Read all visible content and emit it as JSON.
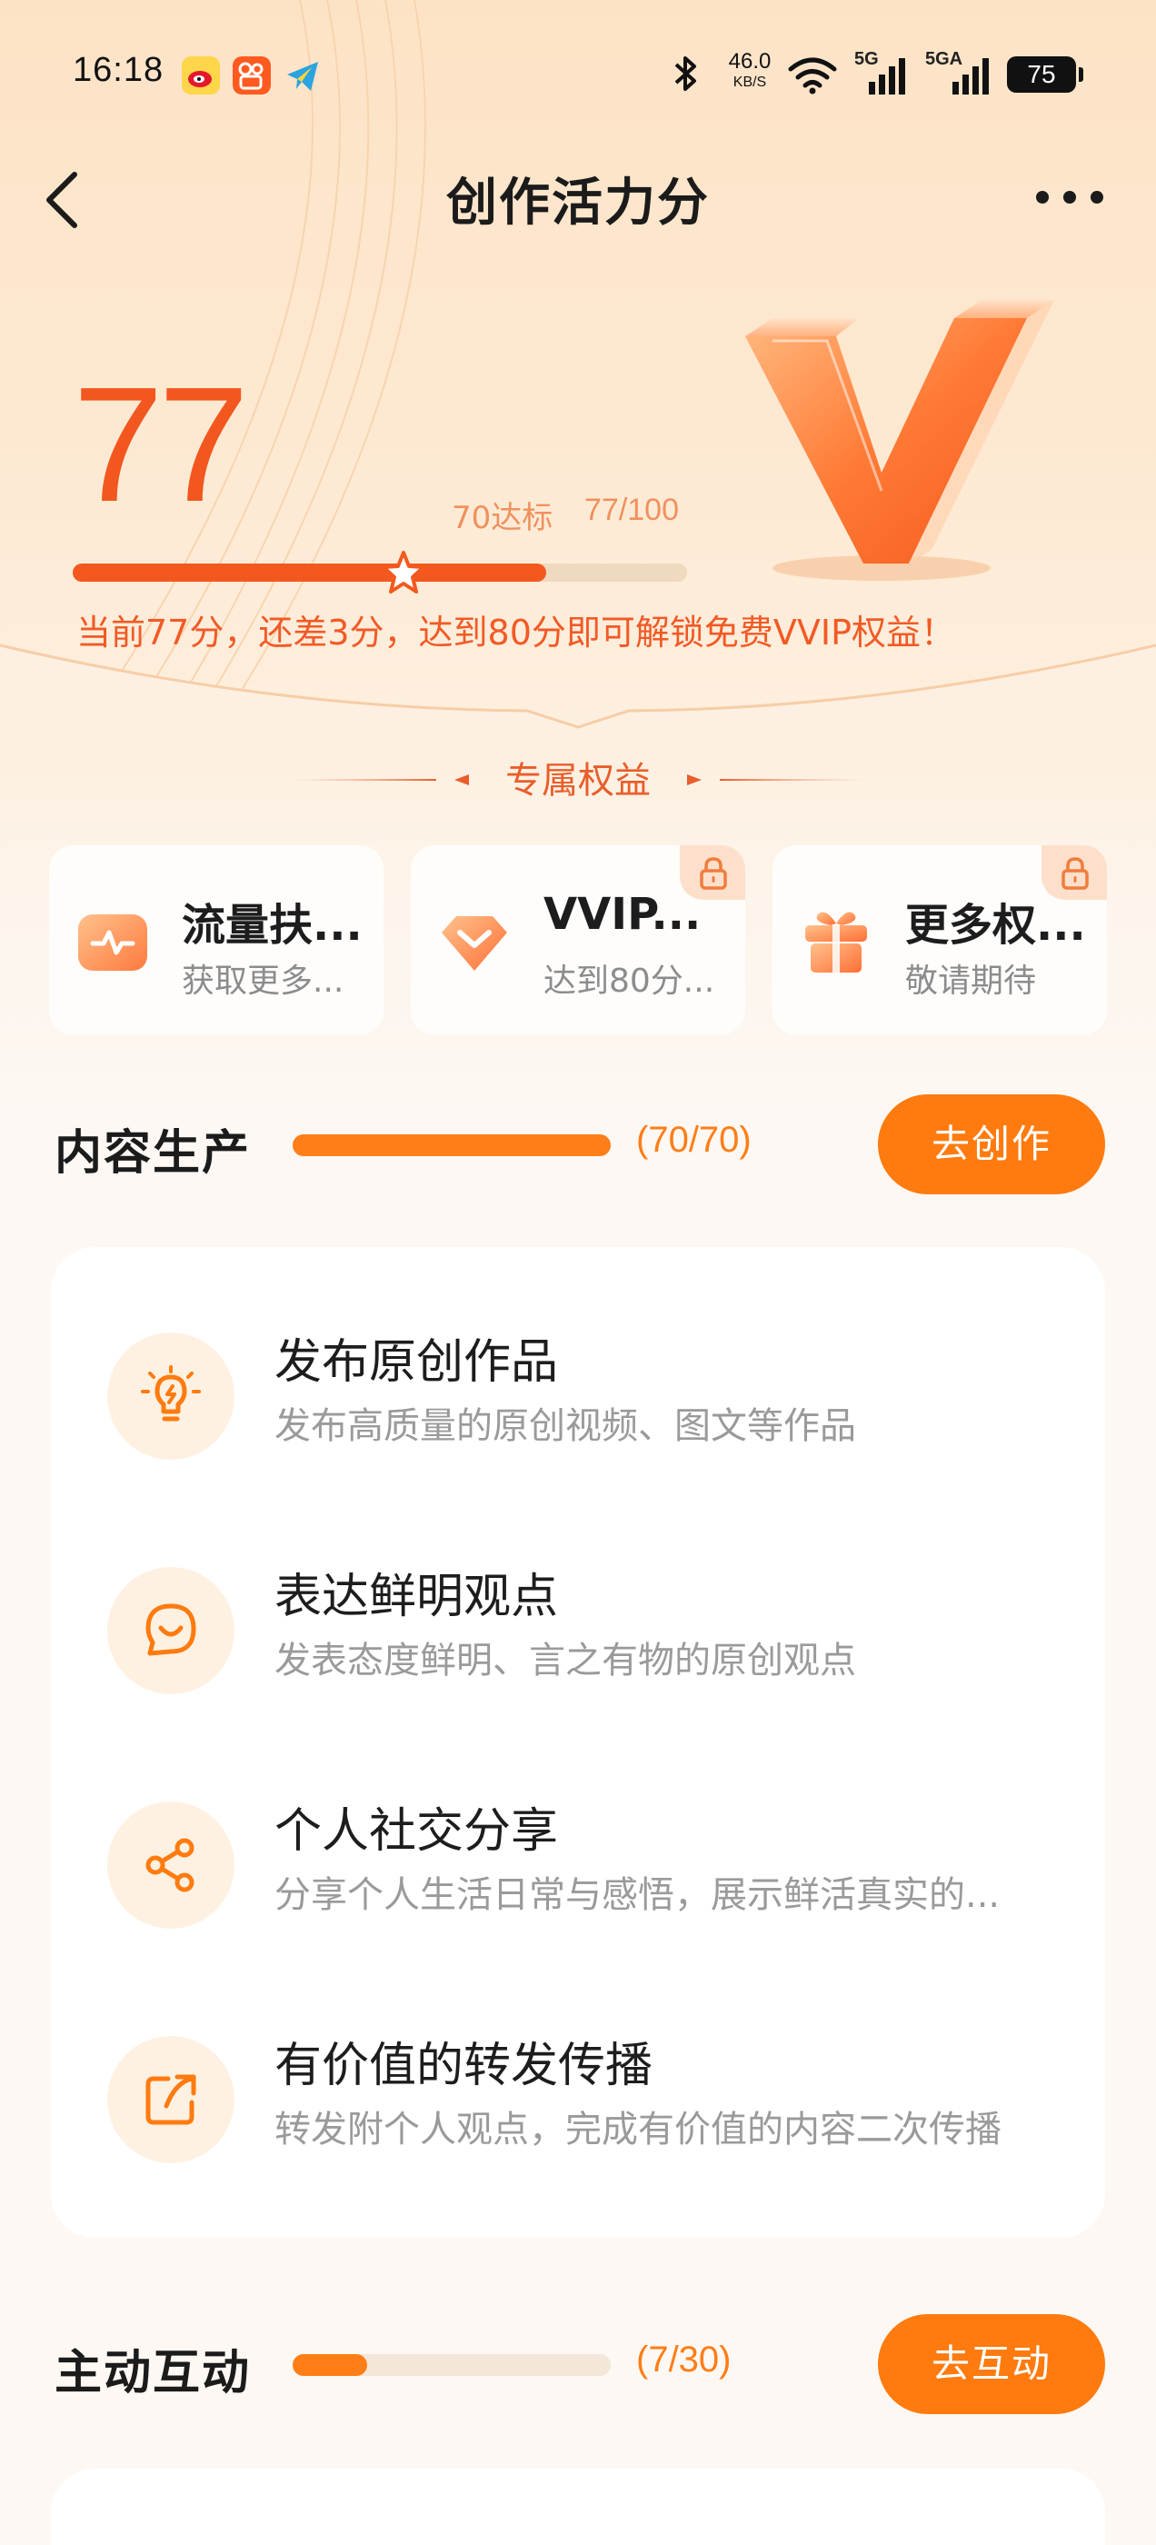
{
  "status_bar": {
    "time": "16:18",
    "net_speed_value": "46.0",
    "net_speed_unit": "KB/S",
    "signal_1_label": "5G",
    "signal_2_label": "5GA",
    "battery": "75",
    "icons": [
      "weibo-app-icon",
      "kuaishou-app-icon",
      "telegram-app-icon",
      "bluetooth-icon",
      "wifi-icon",
      "cellular-signal-icon",
      "cellular-signal-icon",
      "battery-icon"
    ]
  },
  "nav": {
    "title": "创作活力分",
    "back_icon": "chevron-left-icon",
    "more_icon": "more-dots-icon"
  },
  "score": {
    "value": "77",
    "target_label": "70达标",
    "fraction": "77/100",
    "progress_percent": 77,
    "tip": "当前77分，还差3分，达到80分即可解锁免费VVIP权益！"
  },
  "benefits": {
    "title": "专属权益",
    "items": [
      {
        "name": "流量扶...",
        "desc": "获取更多...",
        "icon": "traffic-boost-icon",
        "locked": false
      },
      {
        "name": "VVIP...",
        "desc": "达到80分...",
        "icon": "vvip-diamond-icon",
        "locked": true
      },
      {
        "name": "更多权...",
        "desc": "敬请期待",
        "icon": "gift-icon",
        "locked": true
      }
    ]
  },
  "sections": [
    {
      "title": "内容生产",
      "count": "(70/70)",
      "progress_fraction": 1.0,
      "button": "去创作",
      "tasks": [
        {
          "title": "发布原创作品",
          "desc": "发布高质量的原创视频、图文等作品",
          "icon": "lightbulb-icon"
        },
        {
          "title": "表达鲜明观点",
          "desc": "发表态度鲜明、言之有物的原创观点",
          "icon": "chat-smile-icon"
        },
        {
          "title": "个人社交分享",
          "desc": "分享个人生活日常与感悟，展示鲜活真实的...",
          "icon": "share-icon"
        },
        {
          "title": "有价值的转发传播",
          "desc": "转发附个人观点，完成有价值的内容二次传播",
          "icon": "repost-icon"
        }
      ]
    },
    {
      "title": "主动互动",
      "count": "(7/30)",
      "progress_fraction": 0.233,
      "button": "去互动"
    }
  ],
  "colors": {
    "accent": "#f3591f",
    "button": "#ff7b0f",
    "progress": "#ff7e17"
  }
}
